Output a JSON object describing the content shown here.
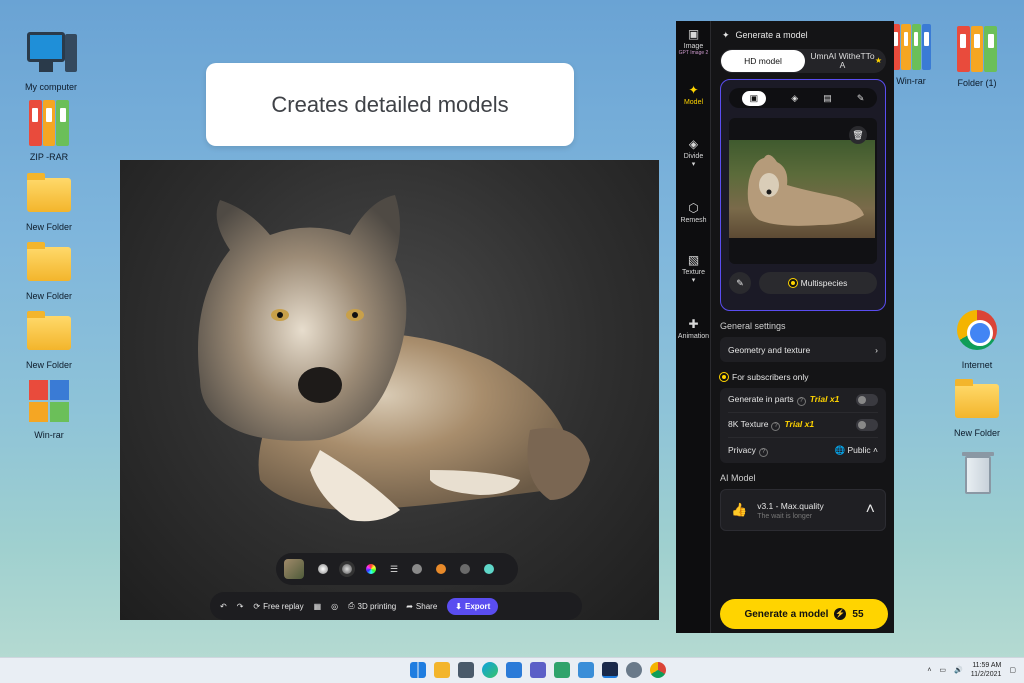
{
  "desktop": {
    "left_icons": [
      {
        "label": "My computer"
      },
      {
        "label": "ZIP -RAR"
      },
      {
        "label": "New Folder"
      },
      {
        "label": "New Folder"
      },
      {
        "label": "New Folder"
      },
      {
        "label": "Win-rar"
      }
    ],
    "right_icons": [
      {
        "label": "Win-rar"
      },
      {
        "label": "Folder (1)"
      },
      {
        "label": "Internet"
      },
      {
        "label": "New Folder"
      }
    ]
  },
  "caption": {
    "text": "Creates detailed models"
  },
  "viewer": {
    "toolbar": {
      "free_replay": "Free replay",
      "print": "3D printing",
      "share": "Share",
      "export": "Export"
    }
  },
  "app": {
    "rail": [
      {
        "label": "Image",
        "icon": "image-icon"
      },
      {
        "label": "Model",
        "icon": "sparkle-icon",
        "active": true
      },
      {
        "label": "Divide",
        "icon": "cube-icon"
      },
      {
        "label": "Remesh",
        "icon": "mesh-icon"
      },
      {
        "label": "Texture",
        "icon": "texture-icon"
      },
      {
        "label": "Animation",
        "icon": "figure-icon"
      }
    ],
    "rail_badge": "GPT Image 2",
    "title": "Generate a model",
    "mode_on": "HD model",
    "mode_off": "UmnAI WitheTTo A",
    "multispecies": "Multispecies",
    "general_settings": "General settings",
    "geometry": "Geometry and texture",
    "subscribers": "For subscribers only",
    "settings": [
      {
        "label": "Generate in parts",
        "trial": "Trial x1"
      },
      {
        "label": "8K Texture",
        "trial": "Trial x1"
      }
    ],
    "privacy": {
      "label": "Privacy",
      "value": "Public"
    },
    "ai_model_label": "AI Model",
    "ai_model": {
      "name": "v3.1 - Max.quality",
      "sub": "The wait is longer"
    },
    "generate": {
      "label": "Generate a model",
      "cost": "55"
    }
  },
  "taskbar": {
    "time": "11:59 AM",
    "date": "11/2/2021"
  },
  "colors": {
    "accent": "#ffd400",
    "panel_bg": "#141416",
    "export": "#5a4df0"
  }
}
